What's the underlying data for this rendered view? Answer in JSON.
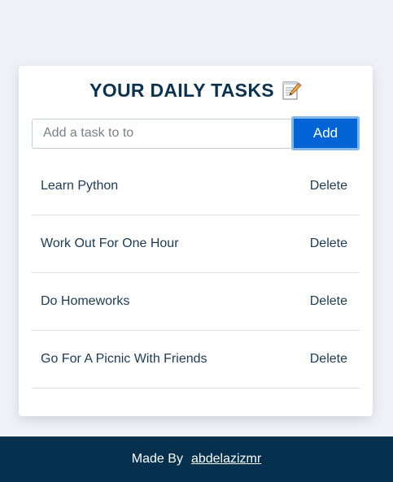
{
  "header": {
    "title": "YOUR DAILY TASKS",
    "title_icon": "memo-icon"
  },
  "form": {
    "input_placeholder": "Add a task to to",
    "input_value": "",
    "add_label": "Add"
  },
  "tasks": [
    {
      "text": "Learn Python",
      "delete_label": "Delete"
    },
    {
      "text": "Work Out For One Hour",
      "delete_label": "Delete"
    },
    {
      "text": "Do Homeworks",
      "delete_label": "Delete"
    },
    {
      "text": "Go For A Picnic With Friends",
      "delete_label": "Delete"
    }
  ],
  "footer": {
    "made_by_label": "Made By",
    "author_link": "abdelazizmr"
  },
  "colors": {
    "page_background": "#eef2f6",
    "title": "#0b3350",
    "add_button": "#0064d6",
    "add_button_focus_ring": "#7fb6ec",
    "footer_background": "#05314f"
  }
}
